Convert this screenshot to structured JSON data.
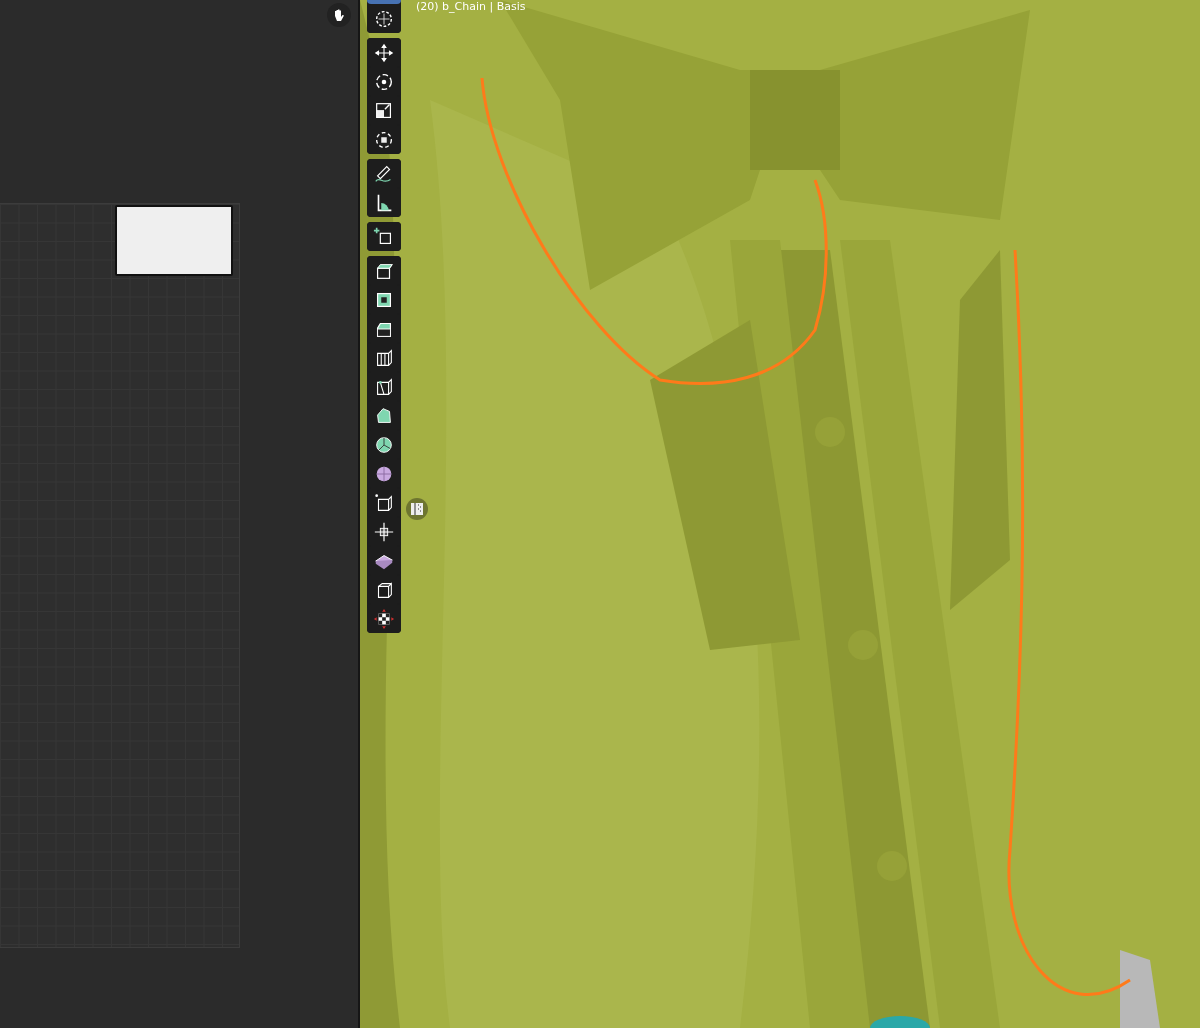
{
  "viewport": {
    "object_label": "(20) b_Chain | Basis"
  },
  "toolbar": {
    "groups": [
      {
        "tools": [
          {
            "selected": true
          },
          {
            "selected": false
          }
        ]
      },
      {
        "tools": [
          {
            "selected": false
          },
          {
            "selected": false
          },
          {
            "selected": false
          },
          {
            "selected": false
          }
        ]
      },
      {
        "tools": [
          {
            "selected": false
          },
          {
            "selected": false
          }
        ]
      },
      {
        "tools": [
          {
            "selected": false
          }
        ]
      },
      {
        "tools": [
          {
            "selected": false
          },
          {
            "selected": false
          },
          {
            "selected": false
          },
          {
            "selected": false
          },
          {
            "selected": false
          },
          {
            "selected": false
          },
          {
            "selected": false
          },
          {
            "selected": false
          },
          {
            "selected": false
          },
          {
            "selected": false
          },
          {
            "selected": false
          },
          {
            "selected": false
          },
          {
            "selected": false
          }
        ]
      }
    ]
  }
}
